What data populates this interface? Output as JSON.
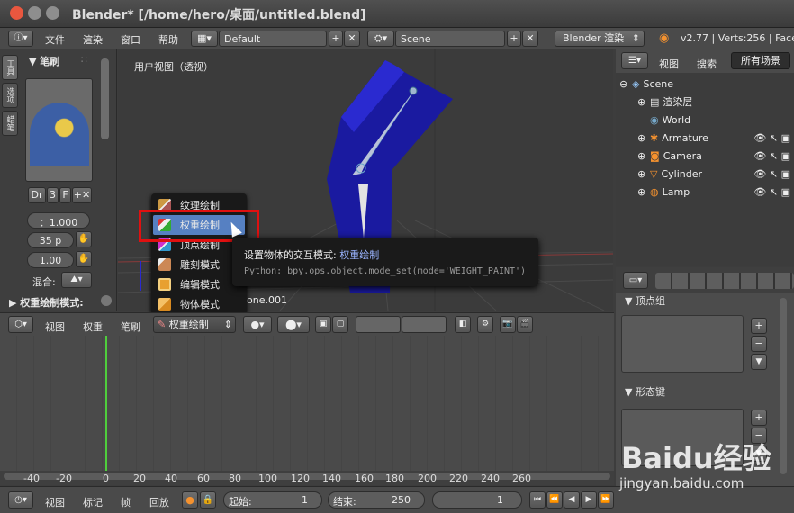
{
  "window": {
    "title": "Blender* [/home/hero/桌面/untitled.blend]"
  },
  "topbar": {
    "menus": [
      "文件",
      "渲染",
      "窗口",
      "帮助"
    ],
    "screen_layout": "Default",
    "scene": "Scene",
    "render_engine": "Blender 渲染",
    "stats": "v2.77 | Verts:256 | Face"
  },
  "toolshelf": {
    "tabs": [
      "工具",
      "选项",
      "蜡笔"
    ],
    "panel_title": "笔刷",
    "brush_buttons": {
      "dr": "Dr",
      "num": "3",
      "f": "F"
    },
    "weight_value": "：1.000",
    "radius_value": "35 p",
    "strength_value": "1.00",
    "blend_label": "混合:",
    "mode_panel": "权重绘制模式:"
  },
  "viewport": {
    "label": "用户视图（透视）",
    "object_name_suffix": "one.001"
  },
  "mode_menu": {
    "items": [
      "纹理绘制",
      "权重绘制",
      "顶点绘制",
      "雕刻模式",
      "编辑模式",
      "物体模式"
    ],
    "selected": 1
  },
  "tooltip": {
    "title_prefix": "设置物体的交互模式: ",
    "title_value": "权重绘制",
    "python": "Python: bpy.ops.object.mode_set(mode='WEIGHT_PAINT')"
  },
  "header3d": {
    "menus": [
      "视图",
      "权重",
      "笔刷"
    ],
    "mode_label": "权重绘制"
  },
  "timeline": {
    "ticks": [
      "-40",
      "-20",
      "0",
      "20",
      "40",
      "60",
      "80",
      "100",
      "120",
      "140",
      "160",
      "180",
      "200",
      "220",
      "240",
      "260"
    ]
  },
  "bottombar": {
    "menus": [
      "视图",
      "标记",
      "帧",
      "回放"
    ],
    "start_label": "起始:",
    "start_value": "1",
    "end_label": "结束:",
    "end_value": "250",
    "current_frame": "1"
  },
  "outliner": {
    "menus": [
      "视图",
      "搜索"
    ],
    "filter": "所有场景",
    "items": [
      "Scene",
      "渲染层",
      "World",
      "Armature",
      "Camera",
      "Cylinder",
      "Lamp"
    ]
  },
  "properties": {
    "vertex_groups": "顶点组",
    "shape_keys": "形态键"
  },
  "watermark": {
    "brand": "Baidu经验",
    "url": "jingyan.baidu.com"
  }
}
